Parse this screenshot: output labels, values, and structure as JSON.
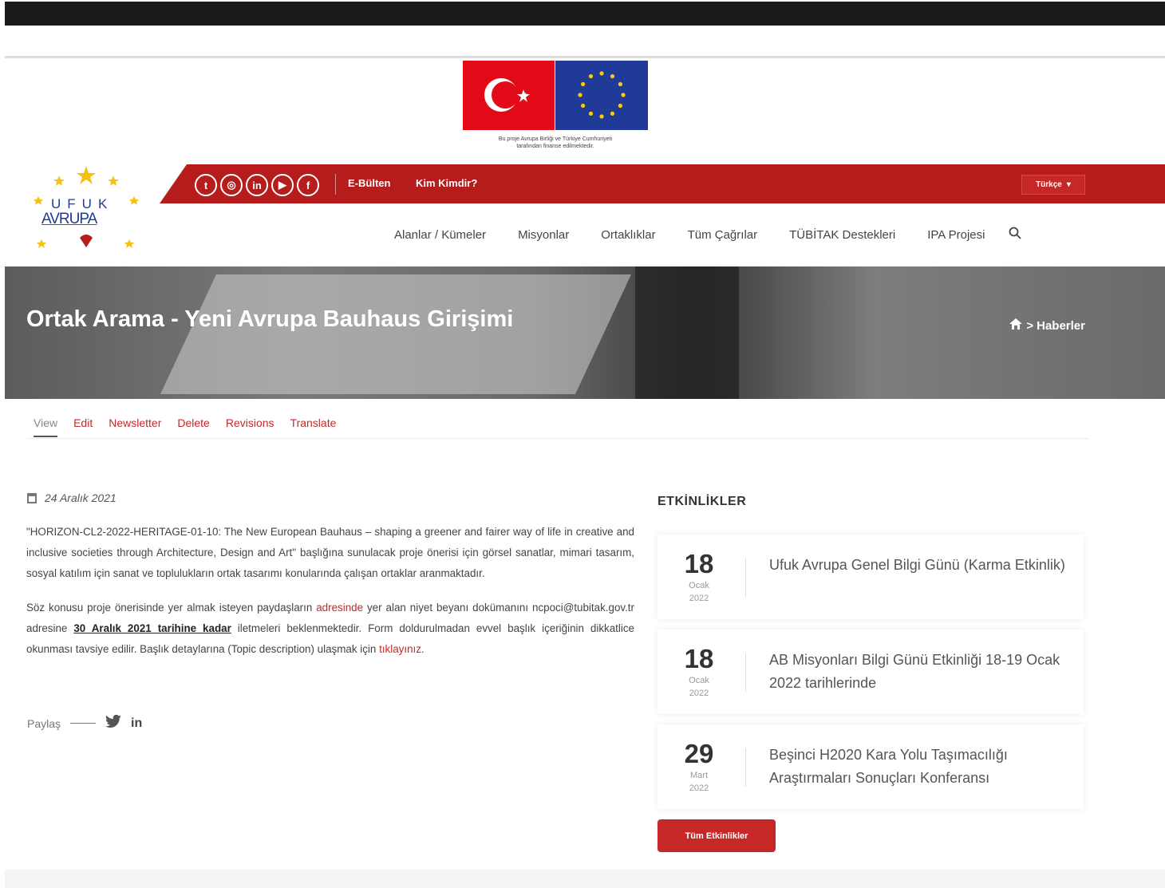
{
  "flag_caption": [
    "Bu proje Avrupa Birliği ve Türkiye Cumhuriyeti",
    "tarafından finanse edilmektedir."
  ],
  "logo": {
    "line1": "UFUK",
    "line2": "AVRUPA"
  },
  "topbar": {
    "social_icons": [
      "twitter-icon",
      "instagram-icon",
      "linkedin-icon",
      "youtube-icon",
      "facebook-icon"
    ],
    "links": [
      "E-Bülten",
      "Kim Kimdir?"
    ],
    "language": "Türkçe"
  },
  "nav": [
    "Alanlar / Kümeler",
    "Misyonlar",
    "Ortaklıklar",
    "Tüm Çağrılar",
    "TÜBİTAK Destekleri",
    "IPA Projesi"
  ],
  "hero": {
    "title": "Ortak Arama - Yeni Avrupa Bauhaus Girişimi",
    "breadcrumb_sep": ">",
    "breadcrumb": "Haberler"
  },
  "tabs": [
    "View",
    "Edit",
    "Newsletter",
    "Delete",
    "Revisions",
    "Translate"
  ],
  "article": {
    "date": "24 Aralık 2021",
    "p1": "\"HORIZON-CL2-2022-HERITAGE-01-10: The New European Bauhaus – shaping a greener and fairer way of life in creative and inclusive societies through Architecture, Design and Art\" başlığına sunulacak proje önerisi için görsel sanatlar, mimari tasarım, sosyal katılım için sanat ve toplulukların ortak tasarımı konularında çalışan ortaklar aranmaktadır.",
    "p2_a": "Söz konusu proje önerisinde yer almak isteyen paydaşların ",
    "p2_link": "adresinde",
    "p2_b": " yer alan niyet beyanı dokümanını ncpoci@tubitak.gov.tr adresine ",
    "p2_strong": "30 Aralık 2021 tarihine kadar",
    "p2_c": " iletmeleri beklenmektedir. Form doldurulmadan evvel başlık içeriğinin dikkatlice okunması tavsiye edilir. Başlık detaylarına (Topic description) ulaşmak için ",
    "p2_link2": "tıklayınız."
  },
  "share": {
    "label": "Paylaş",
    "icons": [
      "twitter-icon",
      "linkedin-icon"
    ]
  },
  "events": {
    "heading": "ETKİNLİKLER",
    "items": [
      {
        "day": "18",
        "month": "Ocak",
        "year": "2022",
        "title": "Ufuk Avrupa Genel Bilgi Günü (Karma Etkinlik)"
      },
      {
        "day": "18",
        "month": "Ocak",
        "year": "2022",
        "title": "AB Misyonları Bilgi Günü Etkinliği 18-19 Ocak 2022 tarihlerinde"
      },
      {
        "day": "29",
        "month": "Mart",
        "year": "2022",
        "title": "Beşinci H2020 Kara Yolu Taşımacılığı Araştırmaları Sonuçları Konferansı"
      }
    ],
    "all_button": "Tüm Etkinlikler"
  },
  "colors": {
    "brand_red": "#b71c1c",
    "eu_blue": "#1f3b97",
    "tr_red": "#e30a17"
  }
}
